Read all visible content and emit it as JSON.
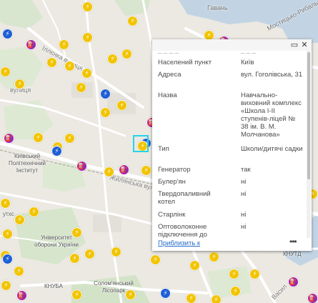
{
  "map": {
    "labels": {
      "gavan": "Гавань",
      "mostytsko_rybalsk": "Мостицько-Рибальськ",
      "illenka": "Іллєнка вулиця",
      "vulytsia": "вулиця",
      "kpi": "Київський Політехнічний Інститут",
      "zhylianska": "Жилянська вулиця",
      "univ_oborony": "Університет оборони України",
      "knuba": "КНУБА",
      "solomianskyi": "Солом'янський Лісопарк",
      "knutd": "КНУТД",
      "utkhs": "утхс",
      "vasylkivska": "Васил"
    }
  },
  "popup": {
    "header_icons": [
      "dock-icon",
      "close-icon"
    ],
    "fields": [
      {
        "key": "Населений пункт",
        "value": "Київ"
      },
      {
        "key": "Адреса",
        "value": "вул. Гоголівська, 31"
      },
      {
        "key": "Назва",
        "value": "Навчально-виховний комплекс «Школа І-ІІ ступенів-ліцей № 38 ім. В. М. Молчанова»"
      },
      {
        "key": "Тип",
        "value": "Школи/дитячі садки"
      },
      {
        "key": "Генератор",
        "value": "так"
      },
      {
        "key": "Булер'ян",
        "value": "ні"
      },
      {
        "key": "Твердопаливний котел",
        "value": "ні"
      },
      {
        "key": "Старлінк",
        "value": "ні"
      },
      {
        "key": "Оптоволоконне підключення до",
        "value": "ні"
      }
    ],
    "zoom_link": "Приблизить к",
    "more_label": "•••"
  },
  "colors": {
    "yellow": "#f2c400",
    "blue": "#1e5fd6",
    "purple": "#a21fb7",
    "selection": "#24d4e8",
    "link": "#2468c9"
  },
  "marker_icons": {
    "yellow": "lightning-icon",
    "blue": "lightning-icon",
    "purple": "fuel-pump-icon"
  }
}
